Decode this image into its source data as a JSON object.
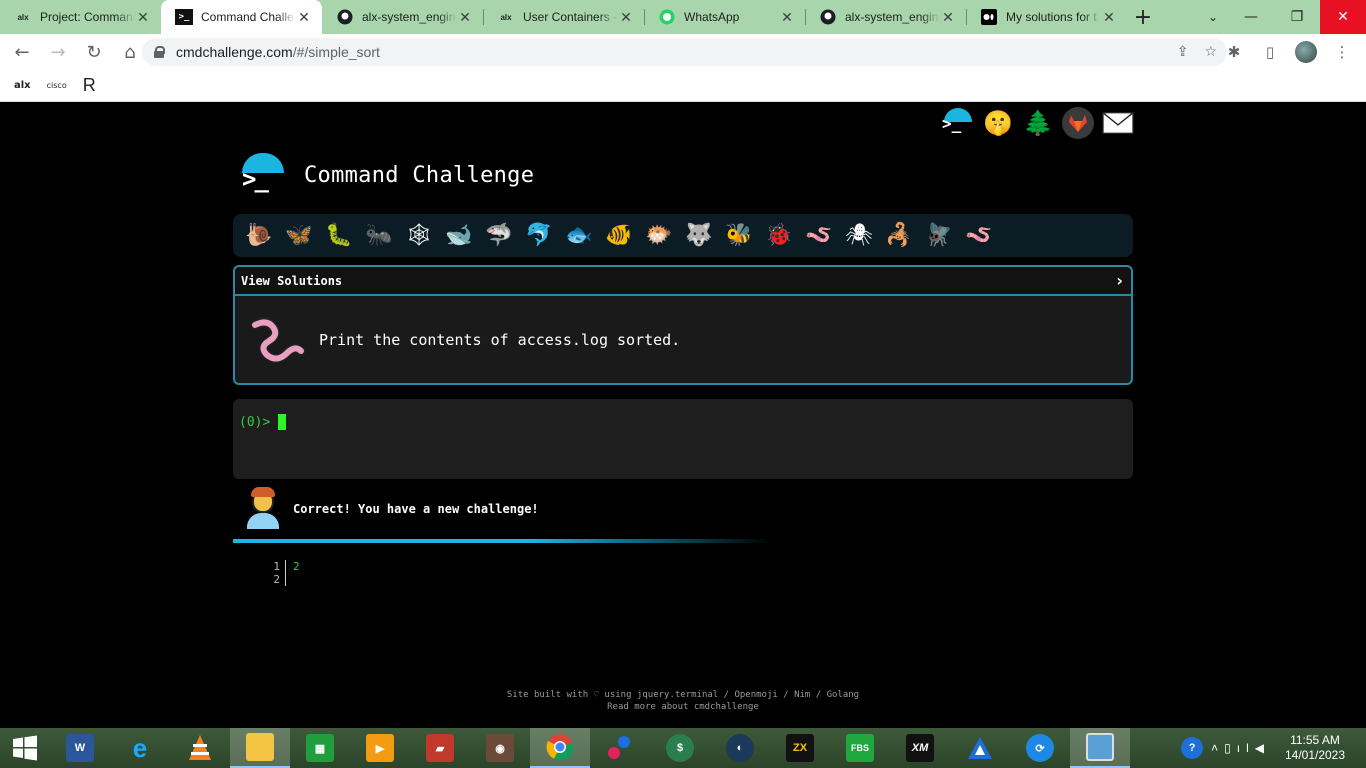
{
  "browser": {
    "tabs": [
      {
        "title": "Project: Command",
        "favicon": "alx"
      },
      {
        "title": "Command Challe",
        "favicon": "terminal-icon",
        "active": true
      },
      {
        "title": "alx-system_engine",
        "favicon": "github-icon"
      },
      {
        "title": "User Containers -",
        "favicon": "alx"
      },
      {
        "title": "WhatsApp",
        "favicon": "whatsapp-icon"
      },
      {
        "title": "alx-system_engine",
        "favicon": "github-icon"
      },
      {
        "title": "My solutions for t",
        "favicon": "medium-icon"
      }
    ],
    "url_host": "cmdchallenge.com",
    "url_path": "/#/simple_sort",
    "bookmarks": [
      "alx",
      "cisco",
      "R"
    ]
  },
  "page": {
    "site_title": "Command Challenge",
    "view_solutions_label": "View Solutions",
    "challenge_text": "Print the contents of access.log sorted.",
    "prompt": "(0)>",
    "feedback": "Correct! You have a new challenge!",
    "output_lines": [
      {
        "n": "1",
        "v": "2"
      },
      {
        "n": "2",
        "v": ""
      }
    ],
    "footer_line1": "Site built with ♡ using jquery.terminal / Openmoji / Nim / Golang",
    "footer_line2": "Read more about cmdchallenge",
    "creatures": [
      "snail-icon",
      "butterfly-icon",
      "caterpillar-icon",
      "ant-icon",
      "spider-web-icon",
      "whale-icon",
      "shark-icon",
      "dolphin-icon",
      "fish-icon",
      "tropical-fish-icon",
      "blowfish-icon",
      "wolf-icon",
      "bee-icon",
      "ladybug-icon",
      "worm-green-icon",
      "spider-icon",
      "scorpion-icon",
      "fly-icon",
      "worm-pink-icon"
    ]
  },
  "taskbar": {
    "time": "11:55 AM",
    "date": "14/01/2023"
  },
  "colors": {
    "accent": "#1cb5e0",
    "border": "#2a8aa5",
    "prompt_green": "#2ecc40",
    "tab_strip": "#a8d5ac"
  }
}
